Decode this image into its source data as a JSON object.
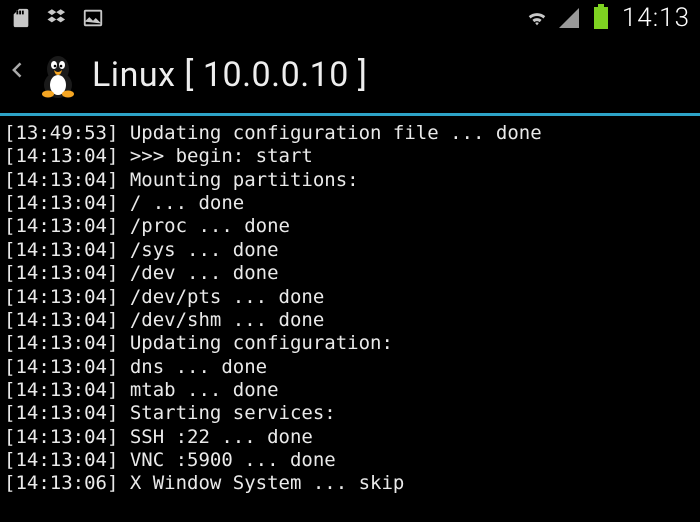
{
  "status_bar": {
    "clock": "14:13",
    "icons": {
      "sd_card": "sd-card-icon",
      "cloud": "dropbox-icon",
      "picture": "picture-icon",
      "wifi": "wifi-icon",
      "signal": "signal-icon",
      "battery": "battery-icon"
    }
  },
  "header": {
    "title_prefix": "Linux",
    "ip": "[ 10.0.0.10 ]"
  },
  "log": [
    {
      "ts": "[13:49:53]",
      "msg": "Updating configuration file ... done"
    },
    {
      "ts": "[14:13:04]",
      "msg": ">>> begin: start"
    },
    {
      "ts": "[14:13:04]",
      "msg": "Mounting partitions:"
    },
    {
      "ts": "[14:13:04]",
      "msg": "/ ... done"
    },
    {
      "ts": "[14:13:04]",
      "msg": "/proc ... done"
    },
    {
      "ts": "[14:13:04]",
      "msg": "/sys ... done"
    },
    {
      "ts": "[14:13:04]",
      "msg": "/dev ... done"
    },
    {
      "ts": "[14:13:04]",
      "msg": "/dev/pts ... done"
    },
    {
      "ts": "[14:13:04]",
      "msg": "/dev/shm ... done"
    },
    {
      "ts": "[14:13:04]",
      "msg": "Updating configuration:"
    },
    {
      "ts": "[14:13:04]",
      "msg": "dns ... done"
    },
    {
      "ts": "[14:13:04]",
      "msg": "mtab ... done"
    },
    {
      "ts": "[14:13:04]",
      "msg": "Starting services:"
    },
    {
      "ts": "[14:13:04]",
      "msg": "SSH :22 ... done"
    },
    {
      "ts": "[14:13:04]",
      "msg": "VNC :5900 ... done"
    },
    {
      "ts": "[14:13:06]",
      "msg": "X Window System ... skip"
    }
  ]
}
